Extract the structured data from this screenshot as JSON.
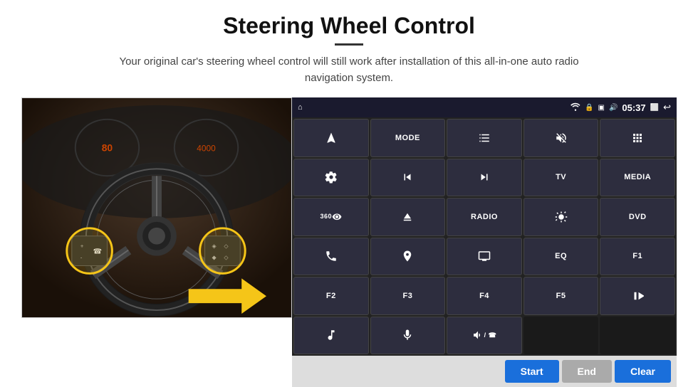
{
  "page": {
    "title": "Steering Wheel Control",
    "subtitle": "Your original car's steering wheel control will still work after installation of this all-in-one auto radio navigation system.",
    "divider": true
  },
  "status_bar": {
    "home_icon": "⌂",
    "wifi_icon": "wifi",
    "lock_icon": "🔒",
    "sim_icon": "sim",
    "bt_icon": "bt",
    "time": "05:37",
    "window_icon": "window",
    "back_icon": "←"
  },
  "buttons": [
    {
      "icon": "navigation",
      "label": "",
      "type": "icon"
    },
    {
      "icon": "",
      "label": "MODE",
      "type": "text"
    },
    {
      "icon": "list",
      "label": "",
      "type": "icon"
    },
    {
      "icon": "mute",
      "label": "",
      "type": "icon"
    },
    {
      "icon": "apps",
      "label": "",
      "type": "icon"
    },
    {
      "icon": "settings",
      "label": "",
      "type": "icon"
    },
    {
      "icon": "prev",
      "label": "",
      "type": "icon"
    },
    {
      "icon": "next",
      "label": "",
      "type": "icon"
    },
    {
      "icon": "",
      "label": "TV",
      "type": "text"
    },
    {
      "icon": "",
      "label": "MEDIA",
      "type": "text"
    },
    {
      "icon": "360cam",
      "label": "",
      "type": "icon"
    },
    {
      "icon": "eject",
      "label": "",
      "type": "icon"
    },
    {
      "icon": "",
      "label": "RADIO",
      "type": "text"
    },
    {
      "icon": "brightness",
      "label": "",
      "type": "icon"
    },
    {
      "icon": "",
      "label": "DVD",
      "type": "text"
    },
    {
      "icon": "phone",
      "label": "",
      "type": "icon"
    },
    {
      "icon": "navigation2",
      "label": "",
      "type": "icon"
    },
    {
      "icon": "screen",
      "label": "",
      "type": "icon"
    },
    {
      "icon": "",
      "label": "EQ",
      "type": "text"
    },
    {
      "icon": "",
      "label": "F1",
      "type": "text"
    },
    {
      "icon": "",
      "label": "F2",
      "type": "text"
    },
    {
      "icon": "",
      "label": "F3",
      "type": "text"
    },
    {
      "icon": "",
      "label": "F4",
      "type": "text"
    },
    {
      "icon": "",
      "label": "F5",
      "type": "text"
    },
    {
      "icon": "play-pause",
      "label": "",
      "type": "icon"
    },
    {
      "icon": "music",
      "label": "",
      "type": "icon"
    },
    {
      "icon": "mic",
      "label": "",
      "type": "icon"
    },
    {
      "icon": "vol-toggle",
      "label": "",
      "type": "icon"
    },
    {
      "icon": "",
      "label": "",
      "type": "empty"
    },
    {
      "icon": "",
      "label": "",
      "type": "empty"
    }
  ],
  "action_bar": {
    "start_label": "Start",
    "end_label": "End",
    "clear_label": "Clear"
  }
}
